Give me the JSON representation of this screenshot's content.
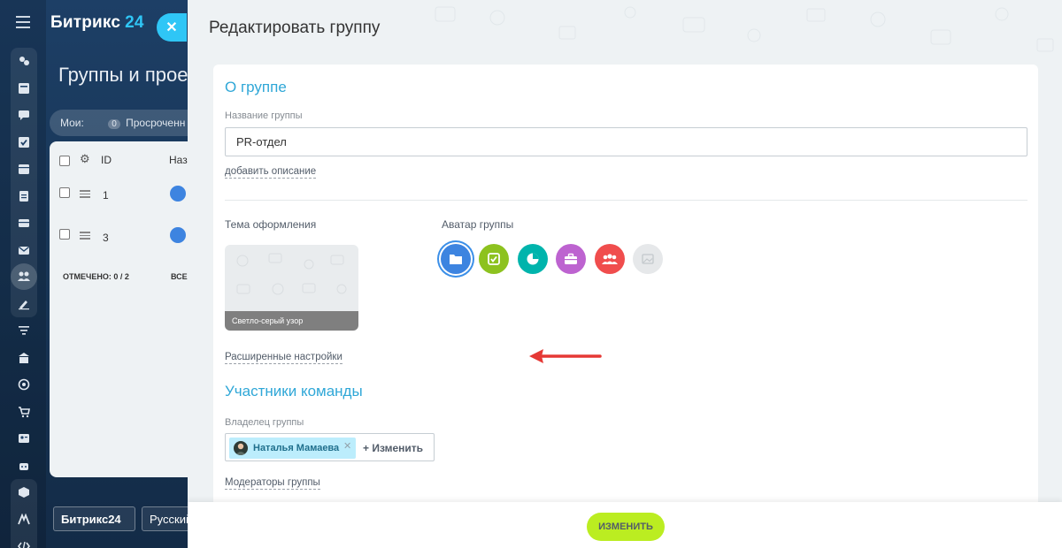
{
  "background_app": {
    "brand_name": "Битрикс",
    "brand_number": "24",
    "page_title": "Группы и проек",
    "filter": {
      "label": "Мои:",
      "count": "0",
      "overdue_label": "Просроченн"
    },
    "table": {
      "header_id": "ID",
      "header_name": "Наз",
      "rows": [
        {
          "id": "1"
        },
        {
          "id": "3"
        }
      ],
      "footer_selected": "ОТМЕЧЕНО: 0 / 2",
      "footer_total": "ВСЕ"
    },
    "footer_buttons": {
      "b24": "Битрикс24",
      "lang": "Русский"
    }
  },
  "slider": {
    "title": "Редактировать группу",
    "about": {
      "section_title": "О группе",
      "name_label": "Название группы",
      "name_value": "PR-отдел",
      "add_description_link": "добавить описание"
    },
    "theme": {
      "label": "Тема оформления",
      "caption": "Светло-серый узор"
    },
    "avatar": {
      "label": "Аватар группы",
      "options": [
        {
          "icon": "folder-icon",
          "color": "#3d84e0"
        },
        {
          "icon": "check-board-icon",
          "color": "#8dc21f"
        },
        {
          "icon": "pie-chart-icon",
          "color": "#00b4ac"
        },
        {
          "icon": "briefcase-icon",
          "color": "#bd63d0"
        },
        {
          "icon": "people-icon",
          "color": "#f04d4d"
        },
        {
          "icon": "image-icon",
          "color": "#e6e8ea"
        }
      ]
    },
    "advanced_settings_link": "Расширенные настройки",
    "team": {
      "section_title": "Участники команды",
      "owner_label": "Владелец группы",
      "owner_name": "Наталья Мамаева",
      "change_label": "+ Изменить",
      "moderators_link": "Модераторы группы"
    },
    "save_button": "ИЗМЕНИТЬ"
  },
  "colors": {
    "accent_blue": "#2fc6f6",
    "section_title": "#2fa7d7",
    "save_button": "#bbed21",
    "annotation_arrow": "#e53935"
  }
}
